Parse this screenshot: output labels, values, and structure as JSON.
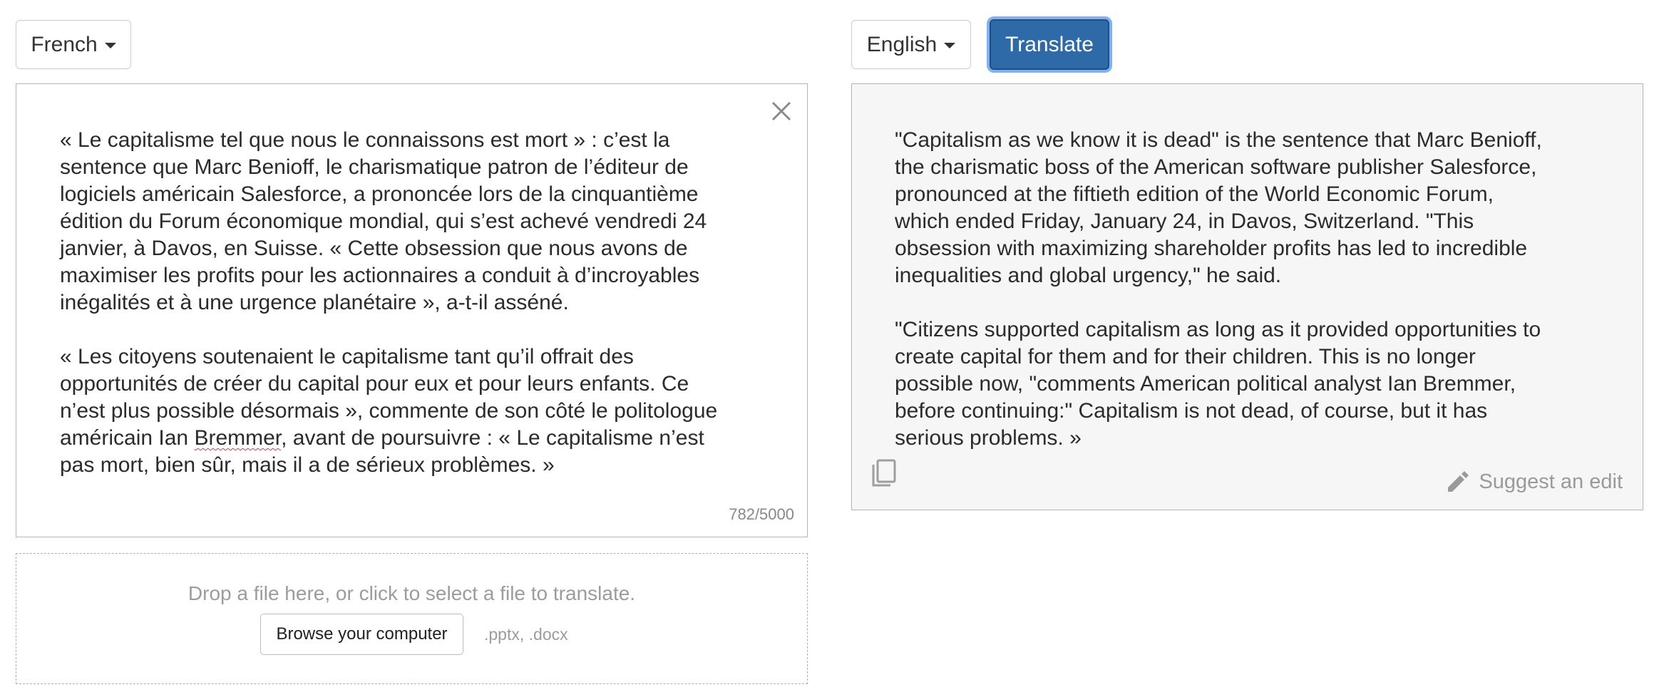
{
  "source": {
    "language": "French",
    "paragraphs": [
      {
        "before": "« Le capitalisme tel que nous le connaissons est mort » : c’est la\nsentence que Marc Benioff, le charismatique patron de l’éditeur de\nlogiciels américain Salesforce, a prononcée lors de la cinquantième\nédition du Forum économique mondial, qui s’est achevé vendredi 24\njanvier, à Davos, en Suisse. « Cette obsession que nous avons de\nmaximiser les profits pour les actionnaires a conduit à d’incroyables\ninégalités et à une urgence planétaire », a-t-il asséné.",
        "flagged": "",
        "after": ""
      },
      {
        "before": "« Les citoyens soutenaient le capitalisme tant qu’il offrait des\nopportunités de créer du capital pour eux et pour leurs enfants. Ce\nn’est plus possible désormais », commente de son côté le politologue\naméricain Ian ",
        "flagged": "Bremmer",
        "after": ", avant de poursuivre : « Le capitalisme n’est\npas mort, bien sûr, mais il a de sérieux problèmes. »"
      }
    ],
    "char_count": "782/5000"
  },
  "target": {
    "language": "English",
    "paragraphs": [
      "\"Capitalism as we know it is dead\" is the sentence that Marc Benioff,\n the charismatic boss of the American software publisher Salesforce,\n pronounced at the fiftieth edition of the World Economic Forum,\n which ended Friday, January 24, in Davos, Switzerland. \"This\n obsession with maximizing shareholder profits has led to incredible\n inequalities and global urgency,\" he said.",
      "\"Citizens supported capitalism as long as it provided opportunities to\n create capital for them and for their children. This is no longer\n possible now, \"comments American political analyst Ian Bremmer,\n before continuing:\" Capitalism is not dead, of course, but it has\n serious problems. »"
    ],
    "suggest_edit_label": "Suggest an edit"
  },
  "toolbar": {
    "translate_label": "Translate"
  },
  "upload": {
    "drop_text": "Drop a file here, or click to select a file to translate.",
    "browse_label": "Browse your computer",
    "file_types": ".pptx, .docx"
  },
  "icons": {
    "caret": "caret-down-icon",
    "clear": "close-icon",
    "copy": "copy-icon",
    "edit": "pencil-icon"
  },
  "colors": {
    "accent": "#2d6aa7",
    "focus_ring": "#5298f4",
    "spellcheck": "#e0393e"
  }
}
